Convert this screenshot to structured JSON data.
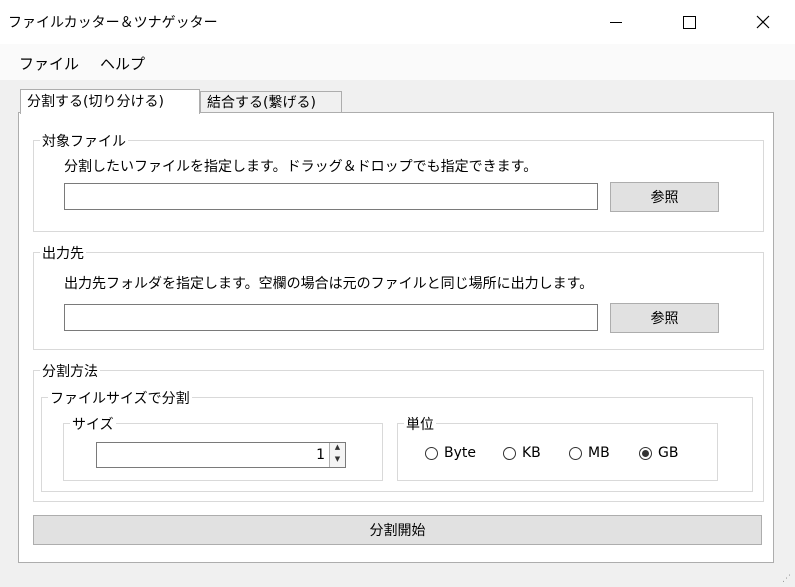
{
  "window": {
    "title": "ファイルカッター＆ツナゲッター"
  },
  "menu": {
    "file": "ファイル",
    "help": "ヘルプ"
  },
  "tabs": [
    {
      "label": "分割する(切り分ける)",
      "active": true
    },
    {
      "label": "結合する(繋げる)",
      "active": false
    }
  ],
  "target": {
    "legend": "対象ファイル",
    "description": "分割したいファイルを指定します。ドラッグ＆ドロップでも指定できます。",
    "path": "",
    "browse_label": "参照"
  },
  "output": {
    "legend": "出力先",
    "description": "出力先フォルダを指定します。空欄の場合は元のファイルと同じ場所に出力します。",
    "path": "",
    "browse_label": "参照"
  },
  "method": {
    "legend": "分割方法",
    "by_size_legend": "ファイルサイズで分割",
    "size_legend": "サイズ",
    "size_value": "1",
    "unit_legend": "単位",
    "units": [
      {
        "label": "Byte",
        "selected": false
      },
      {
        "label": "KB",
        "selected": false
      },
      {
        "label": "MB",
        "selected": false
      },
      {
        "label": "GB",
        "selected": true
      }
    ]
  },
  "start_label": "分割開始"
}
